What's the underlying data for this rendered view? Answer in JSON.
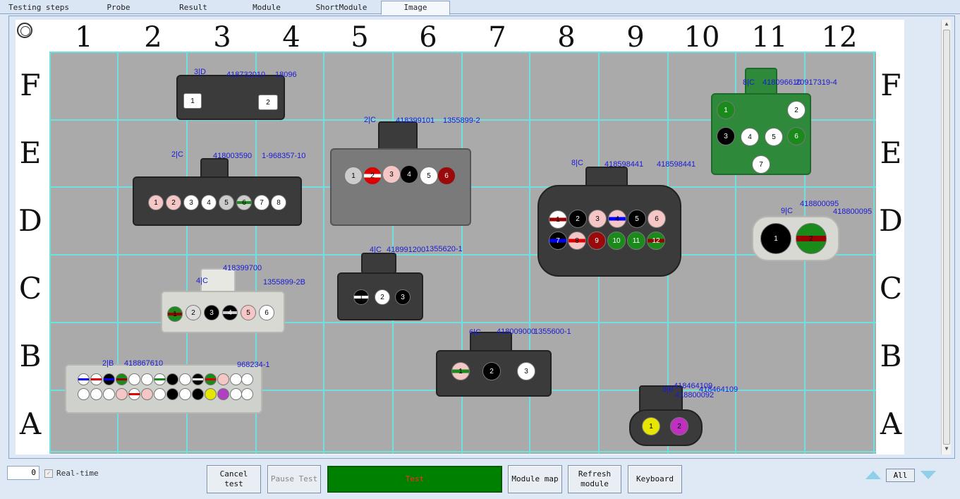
{
  "tabs": [
    {
      "label": "Testing steps"
    },
    {
      "label": "Probe"
    },
    {
      "label": "Result"
    },
    {
      "label": "Module"
    },
    {
      "label": "ShortModule"
    },
    {
      "label": "Image"
    }
  ],
  "grid": {
    "columns": [
      "1",
      "2",
      "3",
      "4",
      "5",
      "6",
      "7",
      "8",
      "9",
      "10",
      "11",
      "12"
    ],
    "rows": [
      "F",
      "E",
      "D",
      "C",
      "B",
      "A"
    ]
  },
  "connectors": {
    "c1": {
      "label": "3|D",
      "part": "418732010",
      "ref": "18096",
      "pins": [
        "1",
        "2"
      ]
    },
    "c2": {
      "label": "2|C",
      "part": "418003590",
      "ref": "1-968357-10",
      "pins": [
        "1",
        "2",
        "3",
        "4",
        "5",
        "6",
        "7",
        "8"
      ]
    },
    "c3": {
      "label": "2|C",
      "part": "418399101",
      "ref": "1355899-2",
      "pins": [
        "1",
        "2",
        "3",
        "4",
        "5",
        "6"
      ]
    },
    "c4": {
      "label": "8|C",
      "part": "418598441",
      "ref": "418598441",
      "pins": [
        "1",
        "2",
        "3",
        "4",
        "5",
        "6",
        "7",
        "8",
        "9",
        "10",
        "11",
        "12"
      ]
    },
    "c5": {
      "label": "8|C",
      "part": "418096610",
      "ref": "20917319-4",
      "pins": [
        "1",
        "2",
        "3",
        "4",
        "5",
        "6",
        "7"
      ]
    },
    "c6": {
      "label": "9|C",
      "part": "418800095",
      "ref": "418800095",
      "pins": [
        "1",
        "2"
      ]
    },
    "c7": {
      "label": "4|C",
      "part": "418399700",
      "ref": "1355899-2B",
      "pins": [
        "1",
        "2",
        "3",
        "4",
        "5",
        "6"
      ]
    },
    "c8": {
      "label": "4|C",
      "part": "418991200",
      "ref": "1355620-1",
      "pins": [
        "1",
        "2",
        "3"
      ]
    },
    "c9": {
      "label": "6|C",
      "part": "418009000",
      "ref": "1355600-1",
      "pins": [
        "1",
        "2",
        "3"
      ]
    },
    "c10": {
      "label": "2|B",
      "part": "418867610",
      "ref": "968234-1"
    },
    "c11": {
      "label": "8|B",
      "part": "418464109",
      "ref": "418464109",
      "extra": "418800092",
      "pins": [
        "1",
        "2"
      ]
    }
  },
  "bottom": {
    "counter_value": "0",
    "realtime_label": "Real-time",
    "cancel_label": "Cancel test",
    "pause_label": "Pause Test",
    "status_text": "Test",
    "module_map_label": "Module map",
    "refresh_label": "Refresh module",
    "keyboard_label": "Keyboard",
    "all_label": "All"
  },
  "colors": {
    "grid_bg": "#aaaaaa",
    "grid_line": "#6ee0df",
    "status_bg": "#008000",
    "annotation": "#1a1ad6"
  }
}
